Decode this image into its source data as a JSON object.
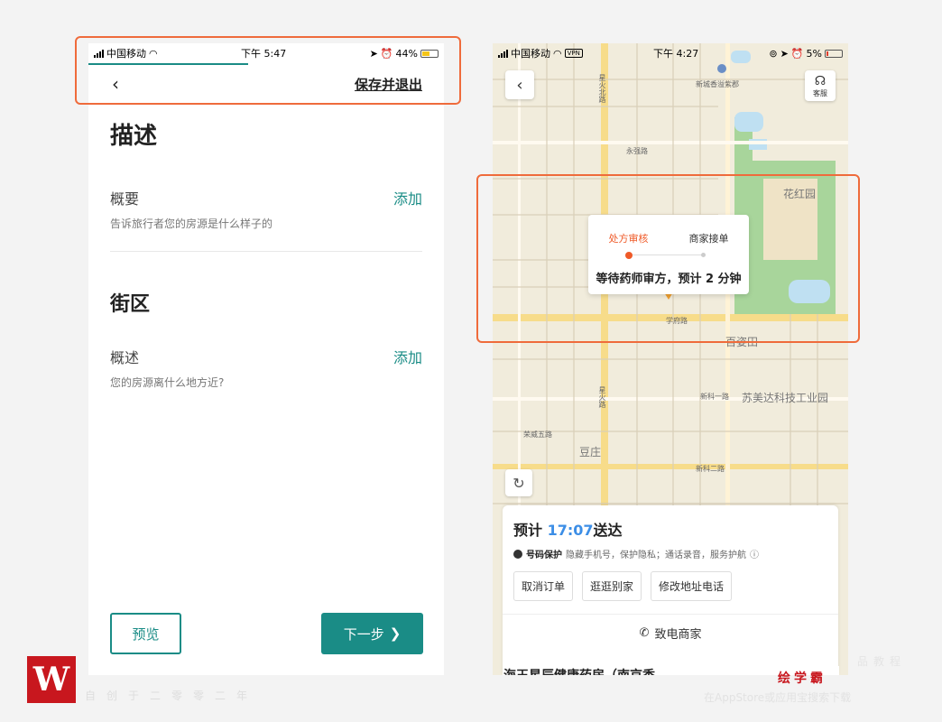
{
  "left": {
    "status": {
      "carrier": "中国移动",
      "time": "下午 5:47",
      "battery": "44%"
    },
    "progress_fraction": 0.45,
    "nav": {
      "save_exit": "保存并退出"
    },
    "section_title": "描述",
    "summary": {
      "label": "概要",
      "action": "添加",
      "hint": "告诉旅行者您的房源是什么样子的"
    },
    "neighborhood_title": "街区",
    "overview": {
      "label": "概述",
      "action": "添加",
      "hint": "您的房源离什么地方近?"
    },
    "buttons": {
      "preview": "预览",
      "next": "下一步"
    }
  },
  "right": {
    "status": {
      "carrier": "中国移动",
      "vpn": "VPN",
      "time": "下午 4:27",
      "battery": "5%"
    },
    "service_label": "客服",
    "map_labels": {
      "xinfeng": "新城香溢紫郡",
      "xingfei": "星火北路",
      "yongqiang": "永强路",
      "huahong": "花红园",
      "xuefu": "学府路",
      "baiyao": "百姿田",
      "sumeida": "苏美达科技工业园",
      "xinke1": "新科一路",
      "xinke2": "新科二路",
      "douzhuang": "豆庄",
      "xinghuo": "星火路",
      "rongwei": "荣威五路"
    },
    "status_card": {
      "step1": "处方审核",
      "step2": "商家接单",
      "message": "等待药师审方，预计 2 分钟"
    },
    "eta": {
      "prefix": "预计",
      "time": "17:07",
      "suffix": "送达"
    },
    "protect": {
      "tag": "号码保护",
      "text": "隐藏手机号，保护隐私；通话录音，服务护航"
    },
    "actions": [
      "取消订单",
      "逛逛别家",
      "修改地址电话"
    ],
    "call": "致电商家",
    "store": "海王星辰健康药房（南京香..."
  },
  "watermark": {
    "brand": "绘学霸",
    "left_text": "自创于二零零二年",
    "right_text": "在AppStore或应用宝搜索下载",
    "right_text2": "品教程"
  },
  "colors": {
    "accent_teal": "#1a8c86",
    "highlight": "#ef6b3b",
    "step_active": "#ef5a28",
    "eta_blue": "#3c8ee6",
    "brand_red": "#c8171e"
  }
}
